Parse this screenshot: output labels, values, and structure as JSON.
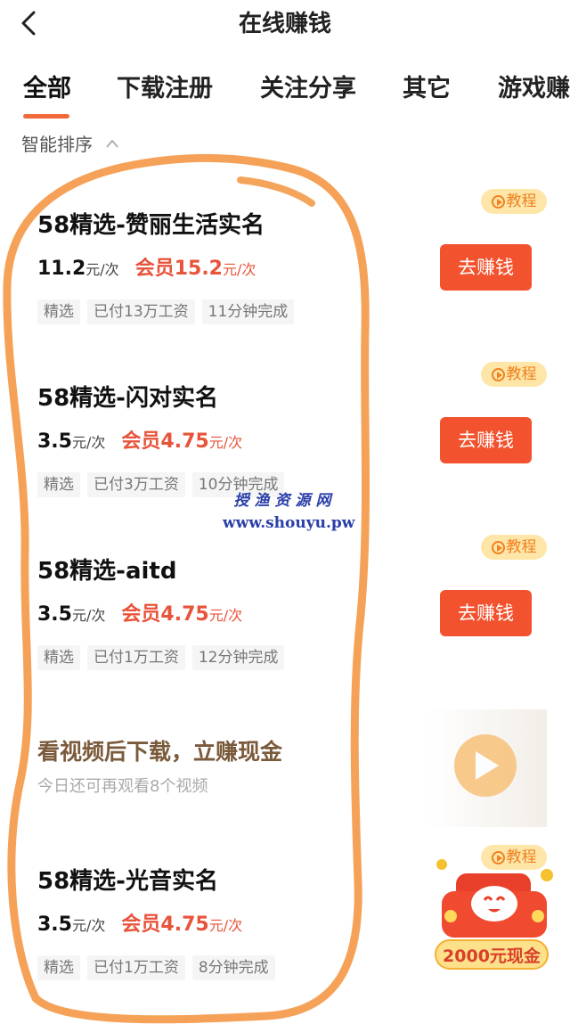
{
  "header": {
    "title": "在线赚钱",
    "back_icon": "chevron-left-icon"
  },
  "tabs": [
    "全部",
    "下载注册",
    "关注分享",
    "其它",
    "游戏赚"
  ],
  "active_tab": "全部",
  "sort": {
    "label": "智能排序",
    "icon": "chevron-up-icon"
  },
  "accent_color": "#f2522e",
  "tasks": [
    {
      "title": "58精选-赞丽生活实名",
      "price": "11.2",
      "unit": "元/次",
      "vip_label": "会员",
      "vip_price": "15.2",
      "vip_unit": "元/次",
      "tags": [
        "精选",
        "已付13万工资",
        "11分钟完成"
      ],
      "button": "去赚钱",
      "tutorial": "教程"
    },
    {
      "title": "58精选-闪对实名",
      "price": "3.5",
      "unit": "元/次",
      "vip_label": "会员",
      "vip_price": "4.75",
      "vip_unit": "元/次",
      "tags": [
        "精选",
        "已付3万工资",
        "10分钟完成"
      ],
      "button": "去赚钱",
      "tutorial": "教程"
    },
    {
      "title": "58精选-aitd",
      "price": "3.5",
      "unit": "元/次",
      "vip_label": "会员",
      "vip_price": "4.75",
      "vip_unit": "元/次",
      "tags": [
        "精选",
        "已付1万工资",
        "12分钟完成"
      ],
      "button": "去赚钱",
      "tutorial": "教程"
    },
    {
      "title": "58精选-光音实名",
      "price": "3.5",
      "unit": "元/次",
      "vip_label": "会员",
      "vip_price": "4.75",
      "vip_unit": "元/次",
      "tags": [
        "精选",
        "已付1万工资",
        "8分钟完成"
      ],
      "button": "",
      "tutorial": "教程"
    }
  ],
  "video_banner": {
    "title": "看视频后下载，立赚现金",
    "subtitle": "今日还可再观看8个视频"
  },
  "promo": {
    "label": "2000元现金"
  },
  "watermark": {
    "line1": "授渔资源网",
    "line2": "www.shouyu.pw"
  }
}
